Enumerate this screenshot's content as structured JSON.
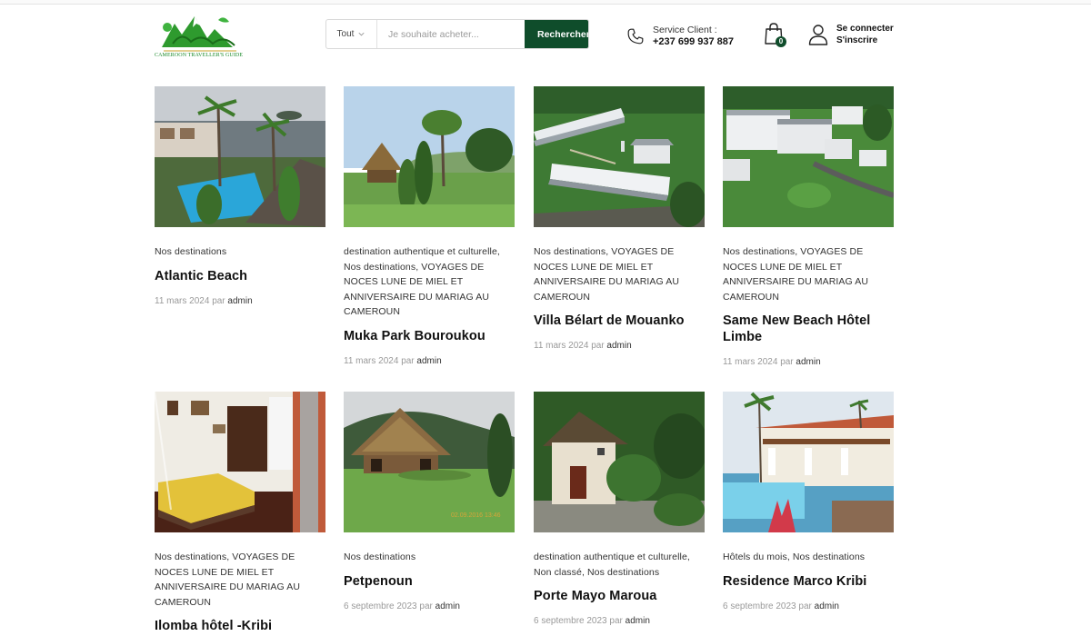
{
  "header": {
    "logo_text": "CAMEROON TRAVELLER'S GUIDE",
    "search": {
      "category": "Tout",
      "placeholder": "Je souhaite acheter...",
      "button": "Rechercher"
    },
    "service": {
      "label": "Service Client :",
      "phone": "+237 699 937 887"
    },
    "cart_count": "0",
    "account": {
      "login": "Se connecter",
      "register": "S'inscrire"
    }
  },
  "posts": [
    {
      "categories": "Nos destinations",
      "title": "Atlantic Beach",
      "date": "11 mars 2024",
      "by": "par",
      "author": "admin"
    },
    {
      "categories": "destination authentique et culturelle, Nos destinations, VOYAGES DE NOCES LUNE DE MIEL ET ANNIVERSAIRE DU MARIAG AU CAMEROUN",
      "title": "Muka Park Bouroukou",
      "date": "11 mars 2024",
      "by": "par",
      "author": "admin"
    },
    {
      "categories": "Nos destinations, VOYAGES DE NOCES LUNE DE MIEL ET ANNIVERSAIRE DU MARIAG AU CAMEROUN",
      "title": "Villa Bélart de Mouanko",
      "date": "11 mars 2024",
      "by": "par",
      "author": "admin"
    },
    {
      "categories": "Nos destinations, VOYAGES DE NOCES LUNE DE MIEL ET ANNIVERSAIRE DU MARIAG AU CAMEROUN",
      "title": "Same New Beach Hôtel Limbe",
      "date": "11 mars 2024",
      "by": "par",
      "author": "admin"
    },
    {
      "categories": "Nos destinations, VOYAGES DE NOCES LUNE DE MIEL ET ANNIVERSAIRE DU MARIAG AU CAMEROUN",
      "title": "Ilomba hôtel -Kribi",
      "date": "",
      "by": "",
      "author": ""
    },
    {
      "categories": "Nos destinations",
      "title": "Petpenoun",
      "date": "6 septembre 2023",
      "by": "par",
      "author": "admin",
      "photo_stamp": "02.09.2016 13:46"
    },
    {
      "categories": "destination authentique et culturelle, Non classé, Nos destinations",
      "title": "Porte Mayo Maroua",
      "date": "6 septembre 2023",
      "by": "par",
      "author": "admin"
    },
    {
      "categories": "Hôtels du mois, Nos destinations",
      "title": "Residence Marco Kribi",
      "date": "6 septembre 2023",
      "by": "par",
      "author": "admin"
    }
  ]
}
